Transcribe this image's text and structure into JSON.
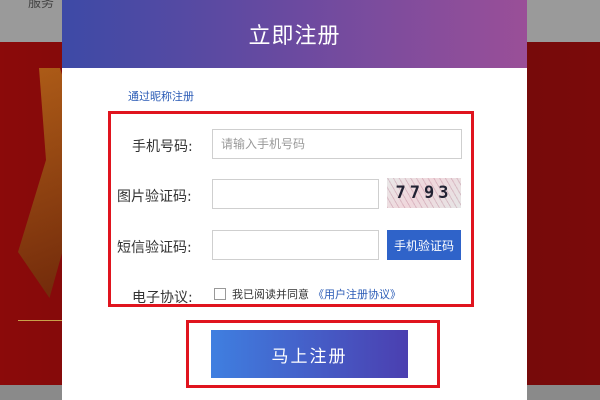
{
  "background": {
    "top_text": "服务"
  },
  "modal": {
    "title": "立即注册",
    "nickname_link": "通过昵称注册",
    "phone": {
      "label": "手机号码:",
      "placeholder": "请输入手机号码",
      "value": ""
    },
    "image_captcha": {
      "label": "图片验证码:",
      "value": "",
      "captcha_text": "7793"
    },
    "sms_code": {
      "label": "短信验证码:",
      "value": "",
      "button_label": "手机验证码"
    },
    "agreement": {
      "label": "电子协议:",
      "checkbox_text": "我已阅读并同意",
      "link_text": "《用户注册协议》",
      "checked": false
    },
    "submit_label": "马上注册"
  },
  "colors": {
    "accent_blue": "#2f63c9",
    "highlight_red": "#e0141e",
    "header_gradient_start": "#3d4aa6",
    "header_gradient_end": "#9a4f98"
  }
}
